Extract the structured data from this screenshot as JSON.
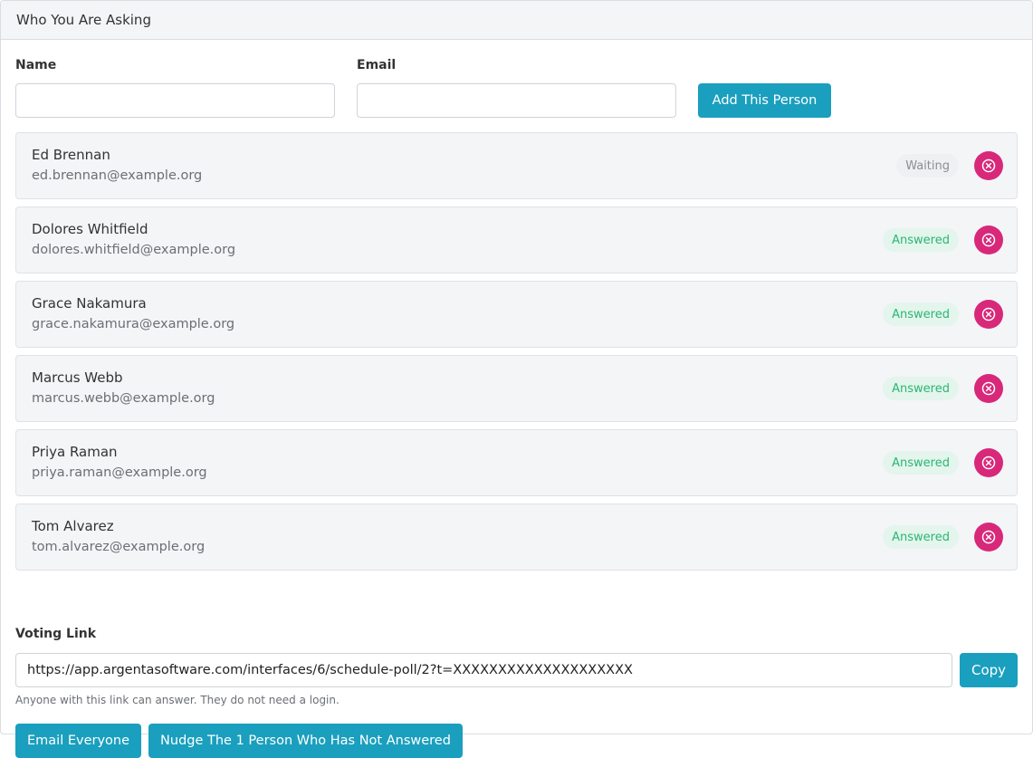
{
  "header": {
    "title": "Who You Are Asking"
  },
  "form": {
    "name_label": "Name",
    "name_value": "",
    "email_label": "Email",
    "email_value": "",
    "add_button_label": "Add This Person"
  },
  "people": [
    {
      "name": "Ed Brennan",
      "email": "ed.brennan@example.org",
      "status": "Waiting"
    },
    {
      "name": "Dolores Whitfield",
      "email": "dolores.whitfield@example.org",
      "status": "Answered"
    },
    {
      "name": "Grace Nakamura",
      "email": "grace.nakamura@example.org",
      "status": "Answered"
    },
    {
      "name": "Marcus Webb",
      "email": "marcus.webb@example.org",
      "status": "Answered"
    },
    {
      "name": "Priya Raman",
      "email": "priya.raman@example.org",
      "status": "Answered"
    },
    {
      "name": "Tom Alvarez",
      "email": "tom.alvarez@example.org",
      "status": "Answered"
    }
  ],
  "voting_link": {
    "label": "Voting Link",
    "url": "https://app.argentasoftware.com/interfaces/6/schedule-poll/2?t=XXXXXXXXXXXXXXXXXXXX",
    "copy_label": "Copy",
    "help_text": "Anyone with this link can answer. They do not need a login."
  },
  "actions": {
    "email_everyone_label": "Email Everyone",
    "nudge_label": "Nudge The 1 Person Who Has Not Answered"
  },
  "colors": {
    "primary": "#1a9fbe",
    "remove": "#d8287a",
    "answered_text": "#2bb673",
    "answered_bg": "#e3f5ec",
    "waiting_text": "#8a8f94",
    "waiting_bg": "#eef0f2"
  },
  "icons": {
    "remove": "close-circle-icon"
  }
}
